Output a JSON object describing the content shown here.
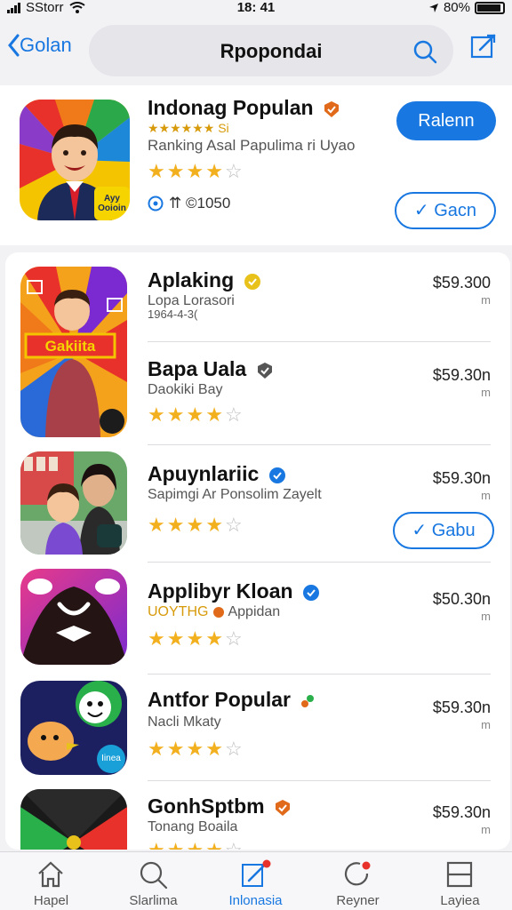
{
  "status_bar": {
    "carrier": "SStorr",
    "time": "18: 41",
    "battery_text": "80%"
  },
  "nav": {
    "back_label": "Golan",
    "search_title": "Rpopondai"
  },
  "featured": {
    "title": "Indonag Populan",
    "small_text": "★★★★★★ Si",
    "subtitle": "Ranking Asal Papulima ri Uyao",
    "rating": 4,
    "meta_text": "⇈ ©1050",
    "primary_button": "Ralenn",
    "secondary_button": "Gacn",
    "icon_badge_text": "Ayy Ooioin"
  },
  "apps": [
    {
      "title": "Aplaking",
      "subtitle": "Lopa Lorasori",
      "subtitle2": "1964-4-3(",
      "price": "$59.300",
      "unit": "m",
      "rating": 0,
      "icon_caption": "Gakiita",
      "badge_color": "#e8c21a"
    },
    {
      "title": "Bapa Uala",
      "subtitle": "Daokiki Bay",
      "price": "$59.30n",
      "unit": "m",
      "rating": 4,
      "badge_color": "#555555"
    },
    {
      "title": "Apuynlariic",
      "subtitle": "Sapimgi Ar Ponsolim Zayelt",
      "price": "$59.30n",
      "unit": "m",
      "rating": 4,
      "action_button": "Gabu",
      "badge_color": "#1877e0"
    },
    {
      "title": "Applibyr Kloan",
      "subtitle": "UOYTHG",
      "subtitle_extra": "Appidan",
      "price": "$50.30n",
      "unit": "m",
      "rating": 4,
      "badge_color": "#1877e0"
    },
    {
      "title": "Antfor Popular",
      "subtitle": "Nacli Mkaty",
      "price": "$59.30n",
      "unit": "m",
      "rating": 4,
      "icon_caption": "Iinea",
      "badge_color": "#e06a1a"
    },
    {
      "title": "GonhSptbm",
      "subtitle": "Tonang Boaila",
      "price": "$59.30n",
      "unit": "m",
      "rating": 4,
      "badge_color": "#e06a1a"
    }
  ],
  "tabs": [
    {
      "label": "Hapel",
      "icon": "home-icon",
      "active": false
    },
    {
      "label": "Slarlima",
      "icon": "search-icon",
      "active": false
    },
    {
      "label": "Inlonasia",
      "icon": "edit-icon",
      "active": true
    },
    {
      "label": "Reyner",
      "icon": "refresh-icon",
      "active": false
    },
    {
      "label": "Layiea",
      "icon": "layers-icon",
      "active": false
    }
  ],
  "colors": {
    "accent": "#1877e0",
    "star": "#f2b01e",
    "background": "#f2f2f5"
  }
}
